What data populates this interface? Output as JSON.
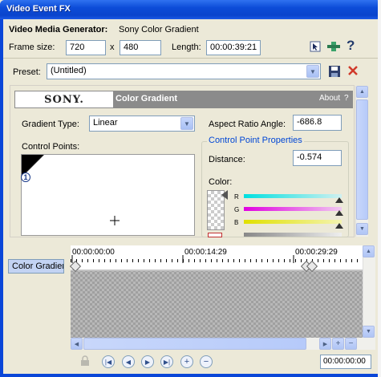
{
  "window": {
    "title": "Video Event FX"
  },
  "generator": {
    "label": "Video Media Generator:",
    "name": "Sony Color Gradient"
  },
  "frame": {
    "label": "Frame size:",
    "width": "720",
    "x": "x",
    "height": "480",
    "length_label": "Length:",
    "length": "00:00:39:21"
  },
  "preset": {
    "label": "Preset:",
    "value": "(Untitled)"
  },
  "plugin": {
    "brand": "SONY.",
    "name": "Color Gradient",
    "about": "About",
    "help": "?"
  },
  "gradient": {
    "type_label": "Gradient Type:",
    "type_value": "Linear",
    "aspect_label": "Aspect Ratio Angle:",
    "aspect_value": "-686.8",
    "cp_label": "Control Points:",
    "cp_marker": "1"
  },
  "cpprops": {
    "title": "Control Point Properties",
    "distance_label": "Distance:",
    "distance_value": "-0.574",
    "color_label": "Color:",
    "r": "R",
    "g": "G",
    "b": "B"
  },
  "timeline": {
    "t0": "00:00:00:00",
    "t1": "00:00:14:29",
    "t2": "00:00:29:29",
    "track": "Color Gradient",
    "time": "00:00:00:00"
  },
  "colors": {
    "title": "#0c4cd8",
    "accent": "#0046d5",
    "close_red": "#d03a2a"
  }
}
